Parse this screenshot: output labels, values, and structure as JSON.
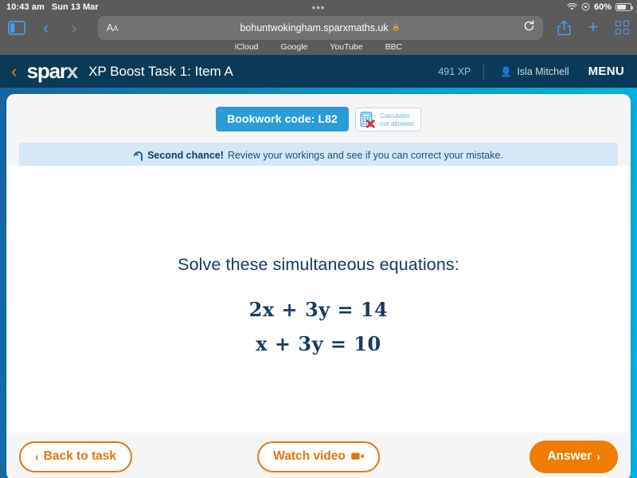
{
  "status_bar": {
    "time": "10:43 am",
    "date": "Sun 13 Mar",
    "battery_percent": "60%",
    "wifi_icon": "wifi-icon",
    "location_icon": "location-icon",
    "battery_icon": "battery-icon",
    "dots": "•••"
  },
  "browser": {
    "sidebar_icon": "sidebar-icon",
    "back_icon": "chevron-left-icon",
    "forward_icon": "chevron-right-icon",
    "text_size_label": "AA",
    "url": "bohuntwokingham.sparxmaths.uk",
    "lock_icon": "lock-icon",
    "reload_icon": "reload-icon",
    "share_icon": "share-icon",
    "new_tab_icon": "plus-icon",
    "tabs_icon": "tab-overview-icon",
    "bookmarks": [
      "iCloud",
      "Google",
      "YouTube",
      "BBC"
    ]
  },
  "app_header": {
    "back_icon": "chevron-left-icon",
    "logo": "sparx",
    "logo_first": "spar",
    "logo_last": "x",
    "task_title": "XP Boost Task 1: Item A",
    "xp": "491 XP",
    "user_icon": "person-icon",
    "user_name": "Isla Mitchell",
    "menu_label": "MENU"
  },
  "badges": {
    "bookwork_code": "Bookwork code: L82",
    "calculator_icon": "calculator-not-allowed-icon",
    "calculator_line1": "Calculator",
    "calculator_line2": "not allowed"
  },
  "banner": {
    "icon": "redo-arrow-icon",
    "title": "Second chance!",
    "message": "Review your workings and see if you can correct your mistake."
  },
  "question": {
    "prompt": "Solve these simultaneous equations:",
    "equation_1": "2x + 3y = 14",
    "equation_2": "x + 3y = 10"
  },
  "footer": {
    "back_chevron": "‹",
    "back_label": "Back to task",
    "watch_label": "Watch video",
    "watch_icon": "video-camera-icon",
    "answer_label": "Answer",
    "answer_chevron": "›"
  },
  "colors": {
    "sparx_navy": "#0a3a57",
    "page_blue_left": "#1464a0",
    "page_blue_right": "#00b4e0",
    "orange": "#f07c00",
    "orange_outline": "#e2760f",
    "bookwork_blue": "#2b9cd8",
    "banner_blue": "#d6e7f7",
    "equation_navy": "#1b3a5e"
  }
}
